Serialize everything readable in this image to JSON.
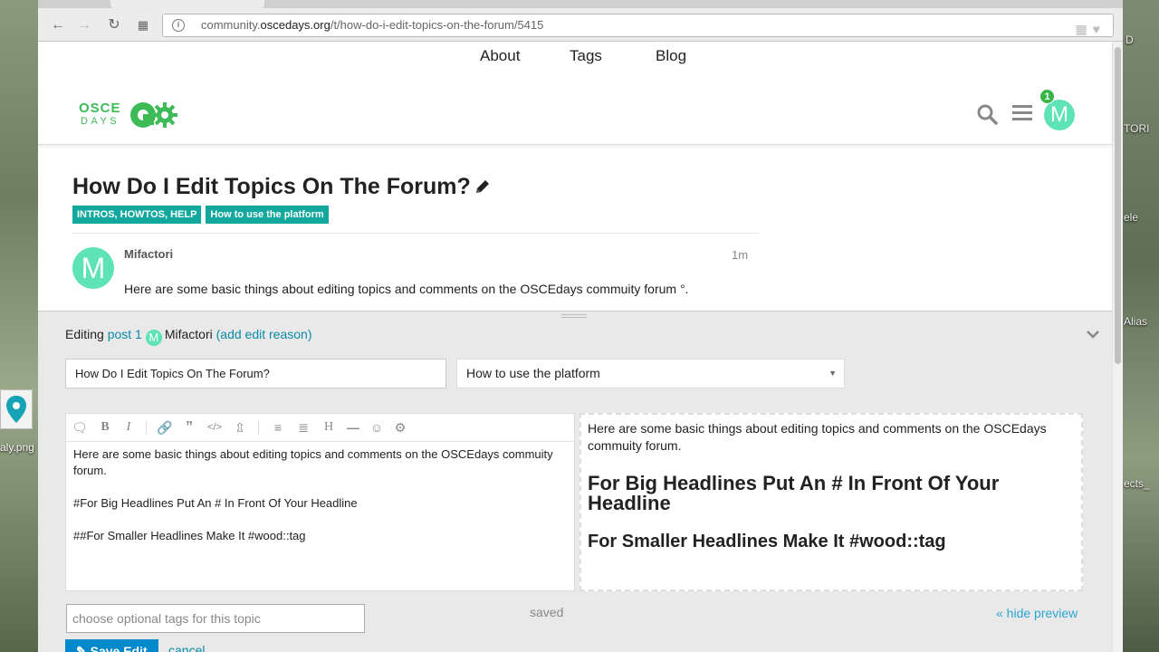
{
  "desktop": {
    "labels": [
      "D",
      "TORI",
      "ele",
      "Alias",
      "ects_"
    ],
    "file_label": "aly.png"
  },
  "browser": {
    "url_prefix": "community.",
    "url_host": "oscedays.org",
    "url_path": "/t/how-do-i-edit-topics-on-the-forum/5415"
  },
  "site": {
    "nav": [
      "About",
      "Tags",
      "Blog"
    ],
    "logo_line1": "OSCE",
    "logo_line2": "DAYS",
    "notification_count": "1",
    "avatar_letter": "M",
    "accent_color": "#3dbb57",
    "badge_color": "#12a89d",
    "avatar_color": "#5ee3b6"
  },
  "topic": {
    "title": "How Do I Edit Topics On The Forum?",
    "categories": [
      "INTROS, HOWTOS, HELP",
      "How to use the platform"
    ],
    "post": {
      "author": "Mifactori",
      "time": "1m",
      "avatar_letter": "M",
      "body": "Here are some basic things about editing topics and comments on the OSCEdays commuity forum °."
    }
  },
  "composer": {
    "editing_prefix": "Editing",
    "post_link": "post 1",
    "avatar_letter": "M",
    "user": "Mifactori",
    "edit_reason": "(add edit reason)",
    "title_value": "How Do I Edit Topics On The Forum?",
    "category_value": "How to use the platform",
    "toolbar_icons": [
      "quote-icon",
      "bold-icon",
      "italic-icon",
      "link-icon",
      "blockquote-icon",
      "code-icon",
      "upload-icon",
      "bullet-list-icon",
      "numbered-list-icon",
      "heading-icon",
      "rule-icon",
      "emoji-icon",
      "options-icon"
    ],
    "editor_lines": [
      "Here are some basic things about editing topics and comments on the OSCEdays commuity forum.",
      "#For Big Headlines Put An # In Front Of Your Headline",
      "##For Smaller Headlines Make It #wood::tag"
    ],
    "preview": {
      "paragraph": "Here are some basic things about editing topics and comments on the OSCEdays commuity forum.",
      "h1": "For Big Headlines Put An # In Front Of Your Headline",
      "h2": "For Smaller Headlines Make It #wood::tag"
    },
    "tags_placeholder": "choose optional tags for this topic",
    "saved_label": "saved",
    "hide_preview_label": "« hide preview",
    "save_label": "Save Edit",
    "cancel_label": "cancel"
  }
}
